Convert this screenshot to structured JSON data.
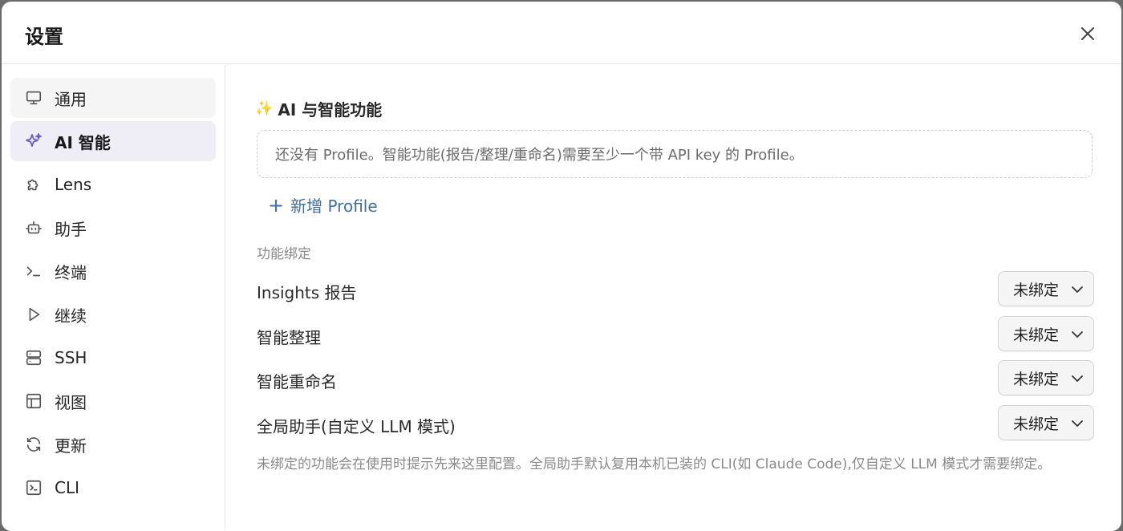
{
  "dialog": {
    "title": "设置"
  },
  "sidebar": {
    "items": [
      {
        "label": "通用",
        "icon": "monitor-icon"
      },
      {
        "label": "AI 智能",
        "icon": "sparkle-icon"
      },
      {
        "label": "Lens",
        "icon": "puzzle-icon"
      },
      {
        "label": "助手",
        "icon": "bot-icon"
      },
      {
        "label": "终端",
        "icon": "terminal-icon"
      },
      {
        "label": "继续",
        "icon": "play-icon"
      },
      {
        "label": "SSH",
        "icon": "server-icon"
      },
      {
        "label": "视图",
        "icon": "layout-icon"
      },
      {
        "label": "更新",
        "icon": "refresh-icon"
      },
      {
        "label": "CLI",
        "icon": "terminal-square-icon"
      }
    ],
    "active_index": 1
  },
  "main": {
    "section_title": "AI 与智能功能",
    "section_emoji": "✨",
    "empty_notice": "还没有 Profile。智能功能(报告/整理/重命名)需要至少一个带 API key 的 Profile。",
    "add_profile_label": "新增 Profile",
    "binding_heading": "功能绑定",
    "bindings": [
      {
        "label": "Insights 报告",
        "value": "未绑定"
      },
      {
        "label": "智能整理",
        "value": "未绑定"
      },
      {
        "label": "智能重命名",
        "value": "未绑定"
      },
      {
        "label": "全局助手(自定义 LLM 模式)",
        "value": "未绑定"
      }
    ],
    "footnote": "未绑定的功能会在使用时提示先来这里配置。全局助手默认复用本机已装的 CLI(如 Claude Code),仅自定义 LLM 模式才需要绑定。"
  },
  "colors": {
    "accent": "#6b5bbd",
    "link": "#3f6fa8",
    "active_bg": "#efedf5"
  }
}
